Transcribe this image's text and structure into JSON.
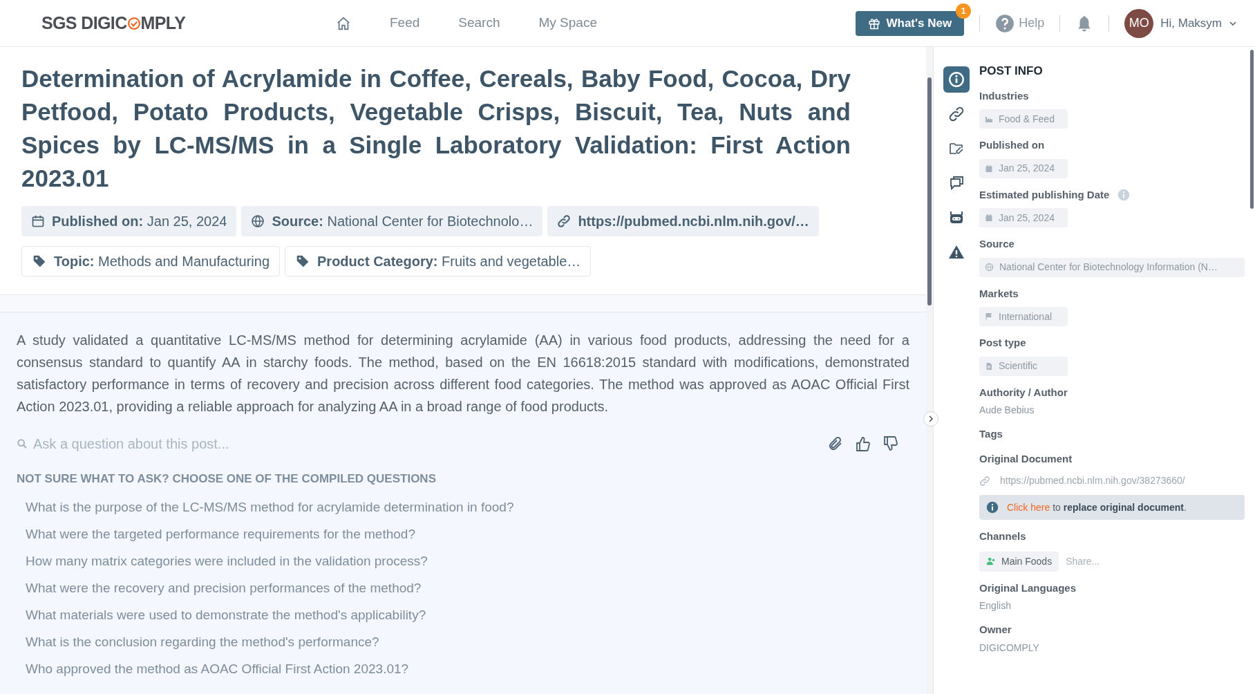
{
  "header": {
    "logo": {
      "left": "SGS DIGIC",
      "right": "MPLY"
    },
    "nav": [
      {
        "kind": "home"
      },
      {
        "kind": "text",
        "label": "Feed"
      },
      {
        "kind": "text",
        "label": "Search"
      },
      {
        "kind": "text",
        "label": "My Space"
      }
    ],
    "whats_new": {
      "label": "What's New",
      "badge": "1"
    },
    "help": "Help",
    "user": {
      "initials": "MO",
      "greeting": "Hi, Maksym"
    }
  },
  "post": {
    "title": "Determination of Acrylamide in Coffee, Cereals, Baby Food, Cocoa, Dry Petfood, Potato Products, Vegetable Crisps, Biscuit, Tea, Nuts and Spices by LC-MS/MS in a Single Laboratory Validation: First Action 2023.01",
    "chips": [
      {
        "kind": "calendar",
        "label": "Published on:",
        "value": "Jan 25, 2024"
      },
      {
        "kind": "globe",
        "label": "Source:",
        "value": "National Center for Biotechnolo…"
      },
      {
        "kind": "link",
        "label": "https://pubmed.ncbi.nlm.nih.gov/…"
      },
      {
        "kind": "tag",
        "label": "Topic:",
        "value": "Methods and Manufacturing"
      },
      {
        "kind": "tag",
        "label": "Product Category:",
        "value": "Fruits and vegetable…"
      }
    ],
    "summary": "A study validated a quantitative LC-MS/MS method for determining acrylamide (AA) in various food products, addressing the need for a consensus standard to quantify AA in starchy foods. The method, based on the EN 16618:2015 standard with modifications, demonstrated satisfactory performance in terms of recovery and precision across different food categories. The method was approved as AOAC Official First Action 2023.01, providing a reliable approach for analyzing AA in a broad range of food products.",
    "ask": {
      "placeholder": "Ask a question about this post..."
    },
    "questions_heading": "NOT SURE WHAT TO ASK? CHOOSE ONE OF THE COMPILED QUESTIONS",
    "questions": [
      "What is the purpose of the LC-MS/MS method for acrylamide determination in food?",
      "What were the targeted performance requirements for the method?",
      "How many matrix categories were included in the validation process?",
      "What were the recovery and precision performances of the method?",
      "What materials were used to demonstrate the method's applicability?",
      "What is the conclusion regarding the method's performance?",
      "Who approved the method as AOAC Official First Action 2023.01?"
    ]
  },
  "sidebar": {
    "tabs": [
      {
        "kind": "info",
        "selected": true
      },
      {
        "kind": "link",
        "selected": false
      },
      {
        "kind": "folder",
        "selected": false
      },
      {
        "kind": "chat",
        "selected": false
      },
      {
        "kind": "bot",
        "selected": false
      },
      {
        "kind": "warning",
        "selected": false
      }
    ],
    "title": "POST INFO",
    "fields": [
      {
        "kind": "chip",
        "label": "Industries",
        "value": "Food & Feed"
      },
      {
        "kind": "chip",
        "label": "Published on",
        "value": "Jan 25, 2024"
      },
      {
        "kind": "chip",
        "label": "Estimated publishing Date",
        "info": true,
        "value": "Jan 25, 2024"
      },
      {
        "kind": "chip",
        "label": "Source",
        "value": "National Center for Biotechnology Information (N…"
      },
      {
        "kind": "chip",
        "label": "Markets",
        "value": "International"
      },
      {
        "kind": "chip",
        "label": "Post type",
        "value": "Scientific"
      },
      {
        "kind": "text",
        "label": "Authority / Author",
        "value": "Aude Bebius"
      },
      {
        "kind": "empty",
        "label": "Tags"
      },
      {
        "kind": "document",
        "label": "Original Document",
        "value": "https://pubmed.ncbi.nlm.nih.gov/38273660/",
        "notice": "**Click here** to **replace original document**."
      },
      {
        "kind": "channels",
        "label": "Channels",
        "value": "Main Foods",
        "share": "Share..."
      },
      {
        "kind": "text",
        "label": "Original Languages",
        "value": "English"
      },
      {
        "kind": "text",
        "label": "Owner",
        "value": "DIGICOMPLY"
      }
    ]
  }
}
